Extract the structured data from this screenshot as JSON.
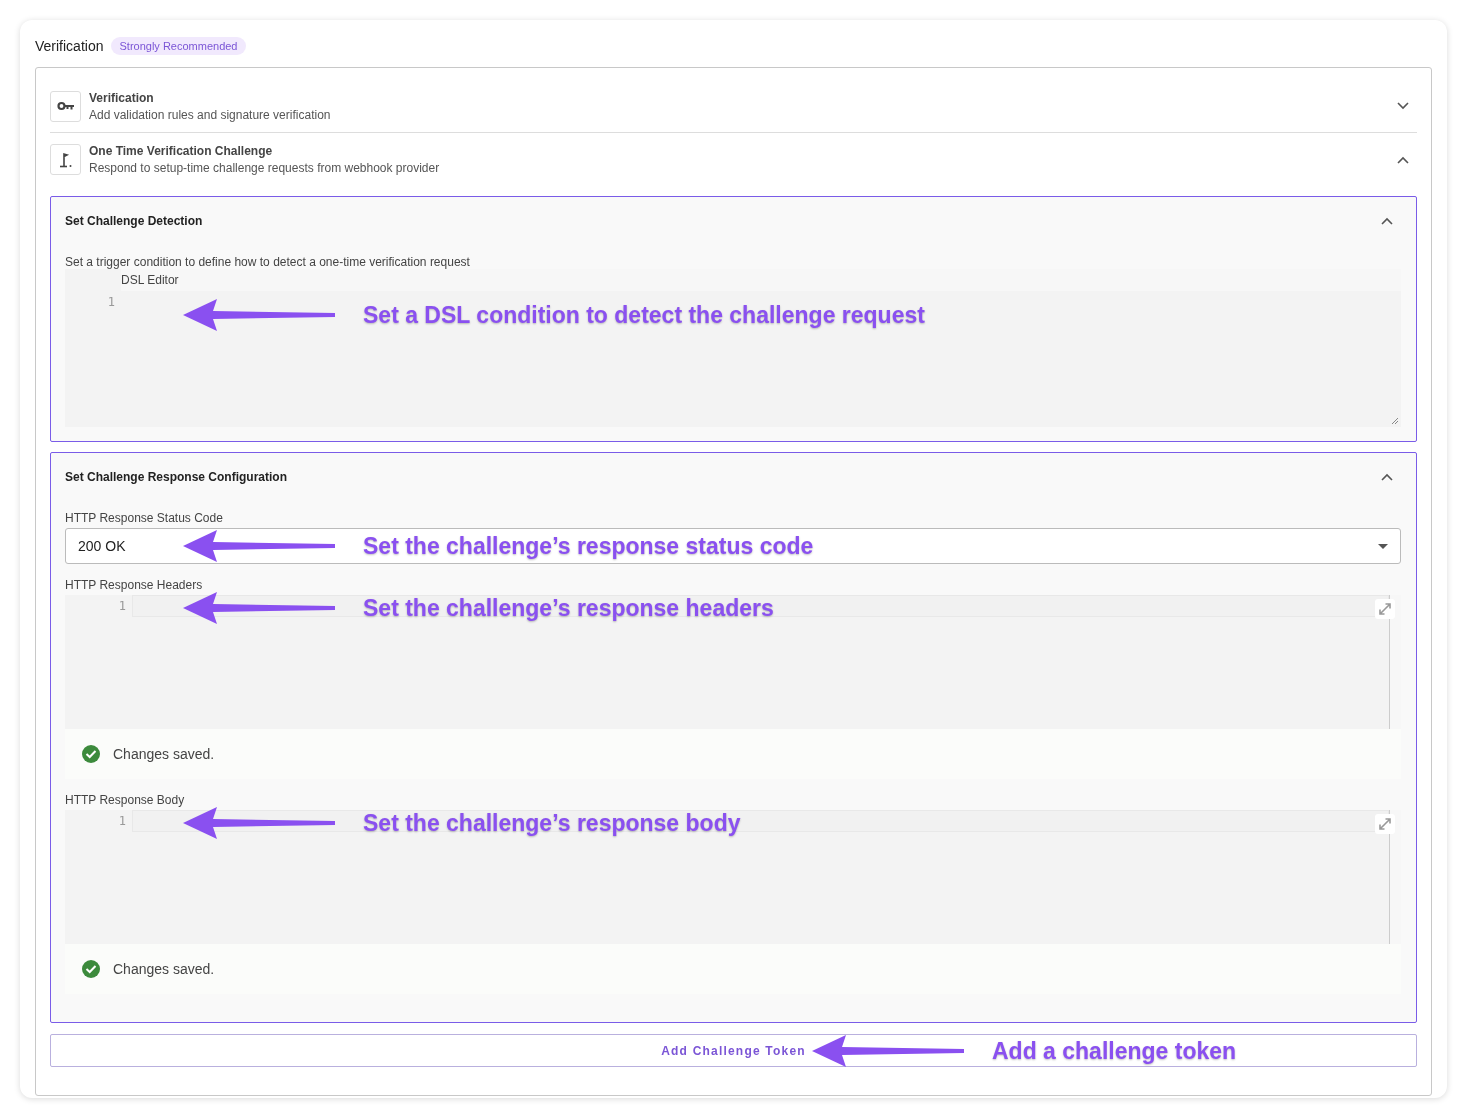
{
  "header": {
    "title": "Verification",
    "badge": "Strongly Recommended"
  },
  "accordion": [
    {
      "kind": "key",
      "title": "Verification",
      "subtitle": "Add validation rules and signature verification",
      "expanded": false
    },
    {
      "kind": "flag",
      "title": "One Time Verification Challenge",
      "subtitle": "Respond to setup-time challenge requests from webhook provider",
      "expanded": true
    }
  ],
  "detection": {
    "title": "Set Challenge Detection",
    "expanded": true,
    "description": "Set a trigger condition to define how to detect a one-time verification request",
    "editor_label": "DSL Editor",
    "line_number": "1",
    "annotation": "Set a DSL condition to detect the challenge request"
  },
  "response": {
    "title": "Set Challenge Response Configuration",
    "expanded": true,
    "status": {
      "label": "HTTP Response Status Code",
      "value": "200 OK",
      "annotation": "Set the challenge’s response status code"
    },
    "editors": [
      {
        "label": "HTTP Response Headers",
        "line_number": "1",
        "status": "Changes saved.",
        "annotation": "Set the challenge’s response headers"
      },
      {
        "label": "HTTP Response Body",
        "line_number": "1",
        "status": "Changes saved.",
        "annotation": "Set the challenge’s response body"
      }
    ]
  },
  "add_button": {
    "label": "Add Challenge Token",
    "annotation": "Add a challenge token"
  }
}
